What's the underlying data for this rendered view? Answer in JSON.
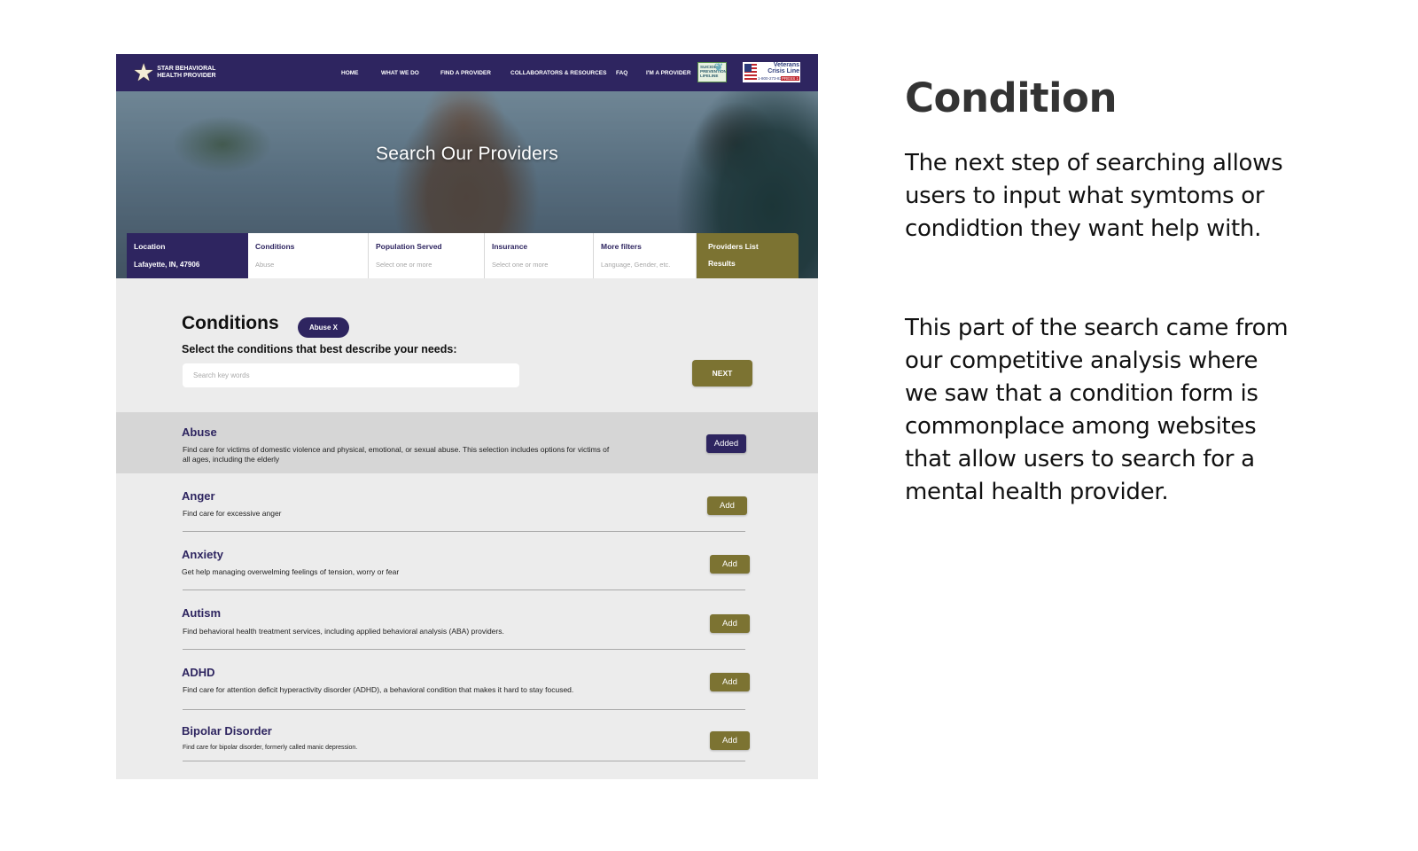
{
  "nav": {
    "logo_text": "STAR BEHAVIORAL HEALTH PROVIDER",
    "links": [
      "HOME",
      "WHAT WE DO",
      "FIND A PROVIDER",
      "COLLABORATORS & RESOURCES",
      "FAQ",
      "I'M A PROVIDER"
    ],
    "suicide_badge": "SUICIDE PREVENTION LIFELINE",
    "veterans_badge": {
      "title": "Veterans Crisis Line",
      "number": "1-800-273-8255",
      "press": "PRESS 1"
    }
  },
  "hero": {
    "title": "Search Our Providers"
  },
  "filters": [
    {
      "label": "Location",
      "value": "Lafayette, IN, 47906"
    },
    {
      "label": "Conditions",
      "value": "Abuse"
    },
    {
      "label": "Population Served",
      "value": "Select one or more"
    },
    {
      "label": "Insurance",
      "value": "Select one or more"
    },
    {
      "label": "More filters",
      "value": "Language, Gender, etc."
    },
    {
      "label": "Providers List",
      "value": "Results"
    }
  ],
  "conditions": {
    "title": "Conditions",
    "chip": "Abuse X",
    "subtitle": "Select the conditions that best describe your needs:",
    "search_placeholder": "Search key words",
    "next_label": "NEXT",
    "items": [
      {
        "name": "Abuse",
        "desc": "Find care for victims of domestic violence and physical, emotional, or sexual abuse. This selection includes options for victims of all ages, including the elderly",
        "button": "Added"
      },
      {
        "name": "Anger",
        "desc": "Find care for excessive anger",
        "button": "Add"
      },
      {
        "name": "Anxiety",
        "desc": "Get help managing overwelming feelings of tension, worry or fear",
        "button": "Add"
      },
      {
        "name": "Autism",
        "desc": "Find behavioral health treatment services, including applied behavioral analysis (ABA) providers.",
        "button": "Add"
      },
      {
        "name": "ADHD",
        "desc": "Find care for attention deficit hyperactivity disorder (ADHD), a behavioral condition that makes it hard to stay focused.",
        "button": "Add"
      },
      {
        "name": "Bipolar Disorder",
        "desc": "Find care for bipolar disorder, formerly called manic depression.",
        "button": "Add"
      }
    ]
  },
  "side": {
    "title": "Condition",
    "p1": "The next step of searching allows users to input what symtoms or condidtion they want help with.",
    "p2": "This part of the search came from our competitive analysis where we saw that a condition form is commonplace among websites that allow users to search for a mental health provider."
  },
  "colors": {
    "brand_purple": "#2e2560",
    "olive": "#7c7332",
    "background": "#ececec"
  }
}
